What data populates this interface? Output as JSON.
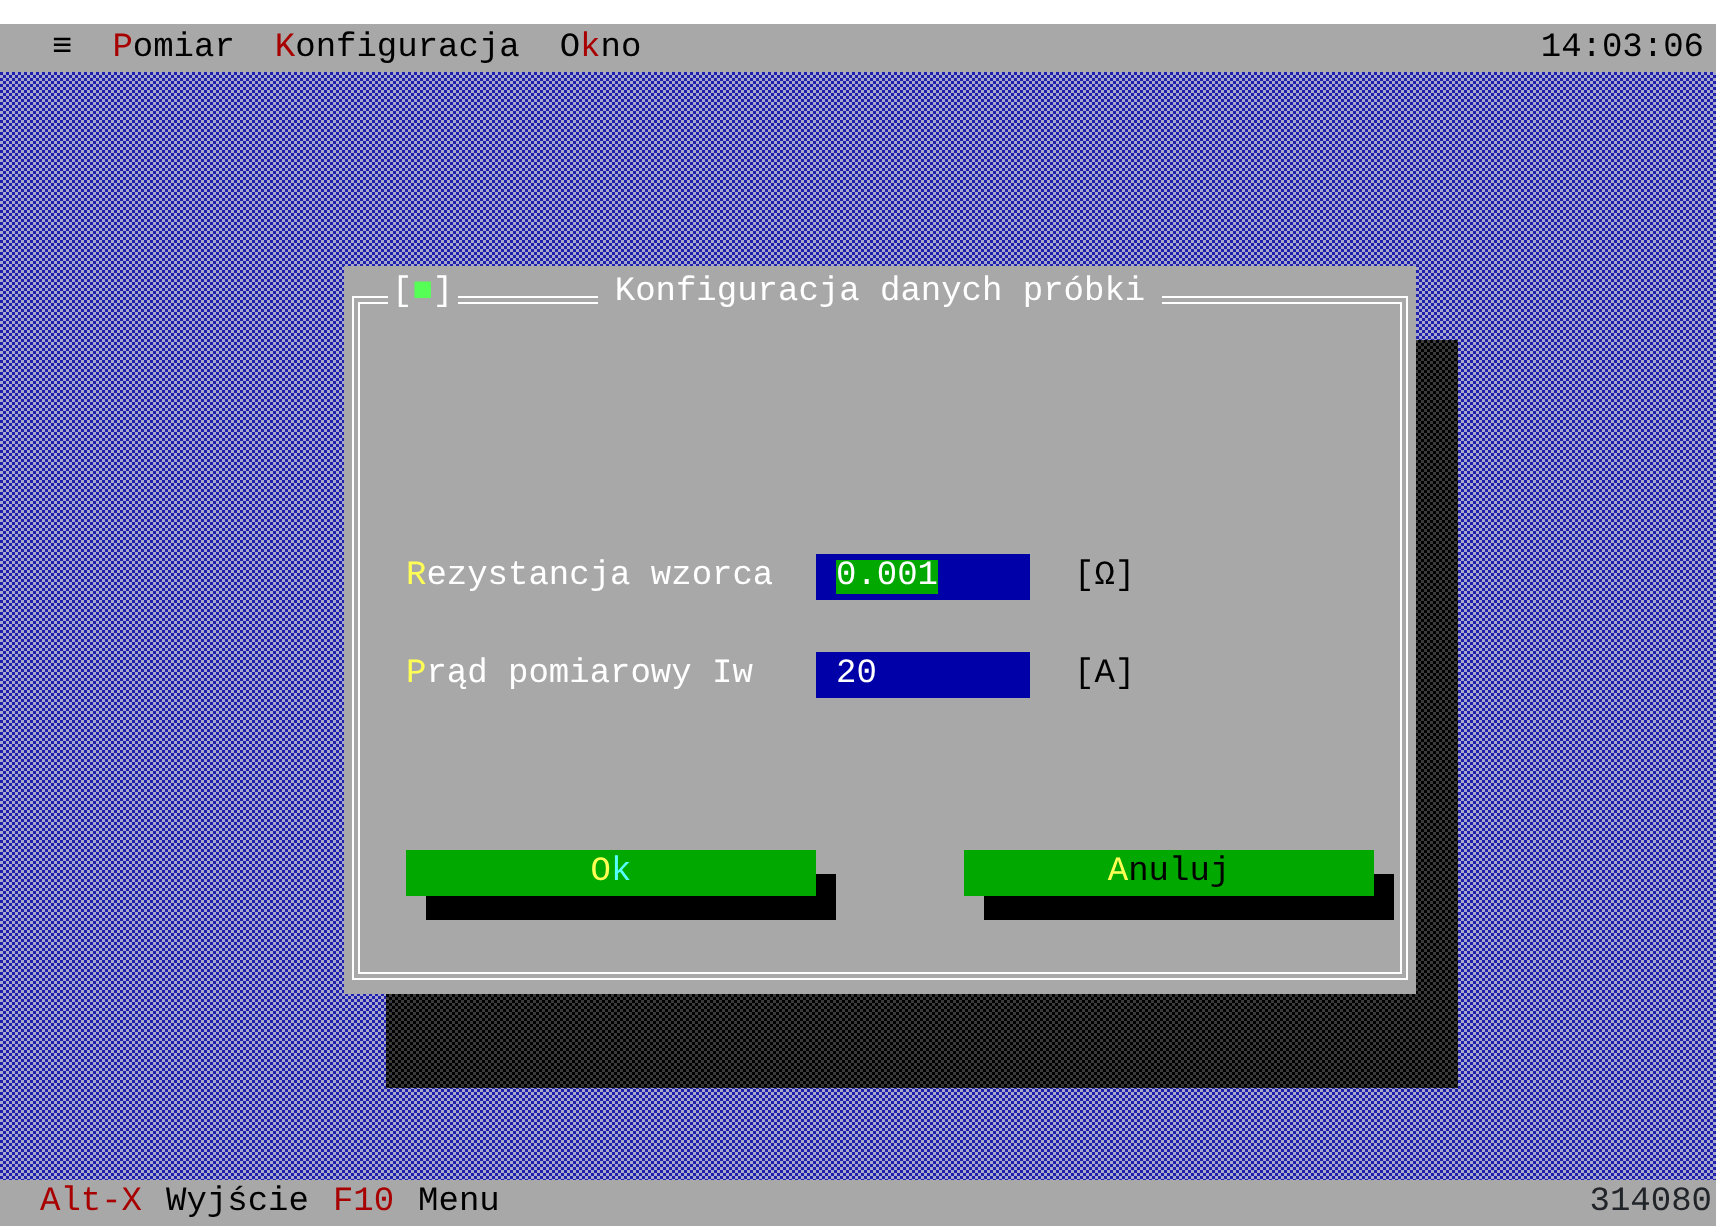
{
  "menu_bar": {
    "system_menu": "≡",
    "items": [
      {
        "label": "**P**omiar"
      },
      {
        "label": "**K**onfiguracja"
      },
      {
        "label": "O**k**no"
      }
    ],
    "clock": "14:03:06"
  },
  "dialog": {
    "close_box": "[**■**]",
    "title": "Konfiguracja danych próbki",
    "fields": [
      {
        "label": "**R**ezystancja wzorca",
        "value": "0.001",
        "selected": true,
        "unit": "[Ω]"
      },
      {
        "label": "**P**rąd pomiarowy Iw",
        "value": "20",
        "selected": false,
        "unit": "[A]"
      }
    ],
    "buttons": [
      {
        "label": "**O**k",
        "default": true
      },
      {
        "label": "**A**nuluj",
        "default": false
      }
    ]
  },
  "status_bar": {
    "items": [
      {
        "key": "Alt-X",
        "label": "Wyjście"
      },
      {
        "key": "F10",
        "label": "Menu"
      }
    ],
    "memory": "314080"
  }
}
